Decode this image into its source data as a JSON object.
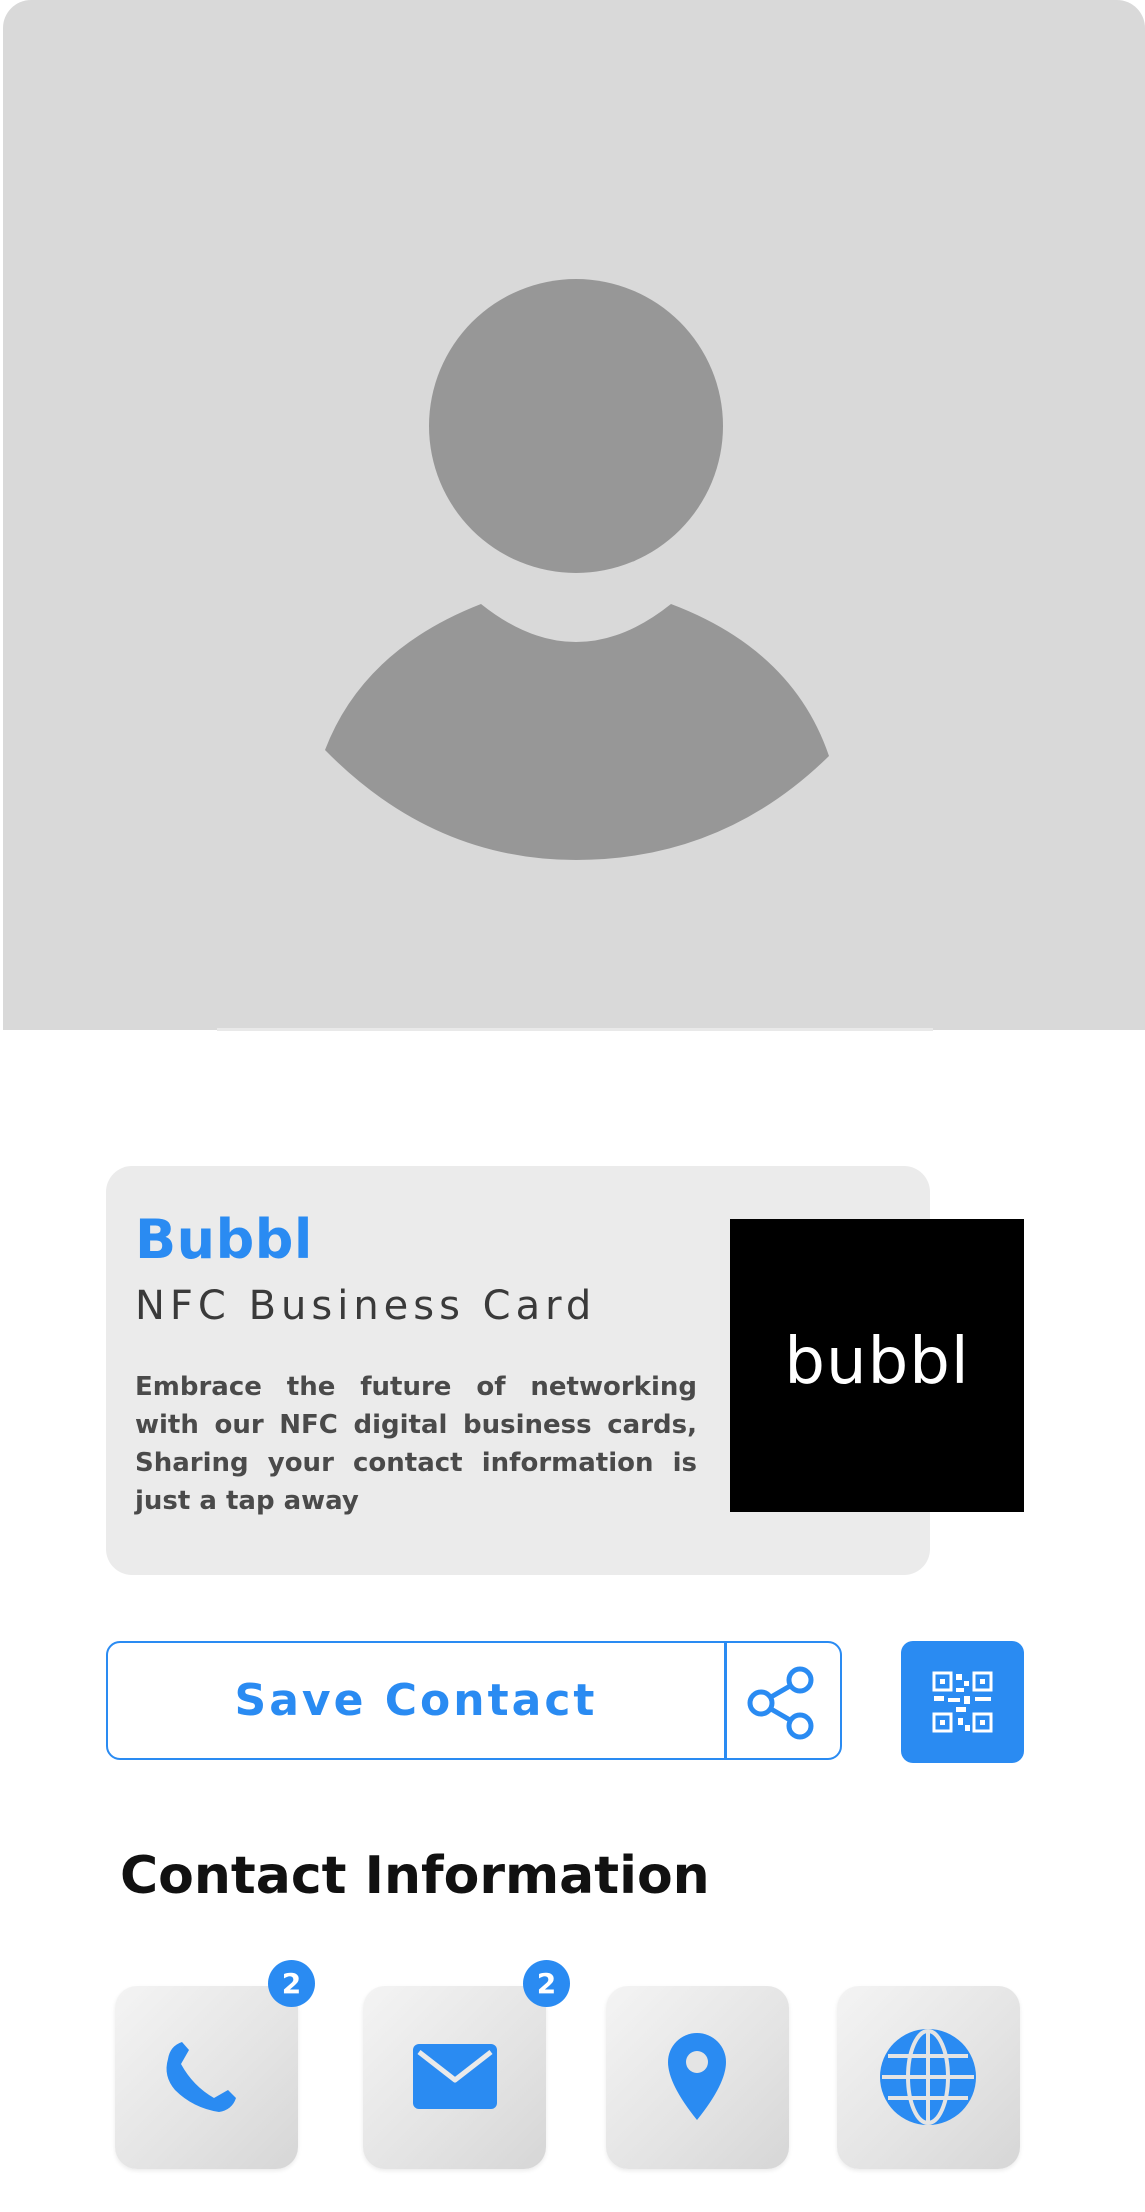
{
  "profile": {
    "photo": "default-avatar-placeholder"
  },
  "card": {
    "title": "Bubbl",
    "subtitle": "NFC Business Card",
    "description": "Embrace the future of networking with our NFC digital business cards, Sharing your contact information is just a tap away",
    "logo_text": "bubbl"
  },
  "actions": {
    "save_label": "Save Contact",
    "share_icon": "share-icon",
    "qr_icon": "qr-code-icon"
  },
  "contact": {
    "section_title": "Contact Information",
    "items": [
      {
        "icon": "phone-icon",
        "badge": "2"
      },
      {
        "icon": "mail-icon",
        "badge": "2"
      },
      {
        "icon": "location-pin-icon",
        "badge": ""
      },
      {
        "icon": "globe-icon",
        "badge": ""
      }
    ]
  },
  "colors": {
    "accent": "#2a8bf2",
    "hero_bg": "#d9d9d9",
    "avatar": "#979797",
    "card_bg": "#ebebeb"
  }
}
